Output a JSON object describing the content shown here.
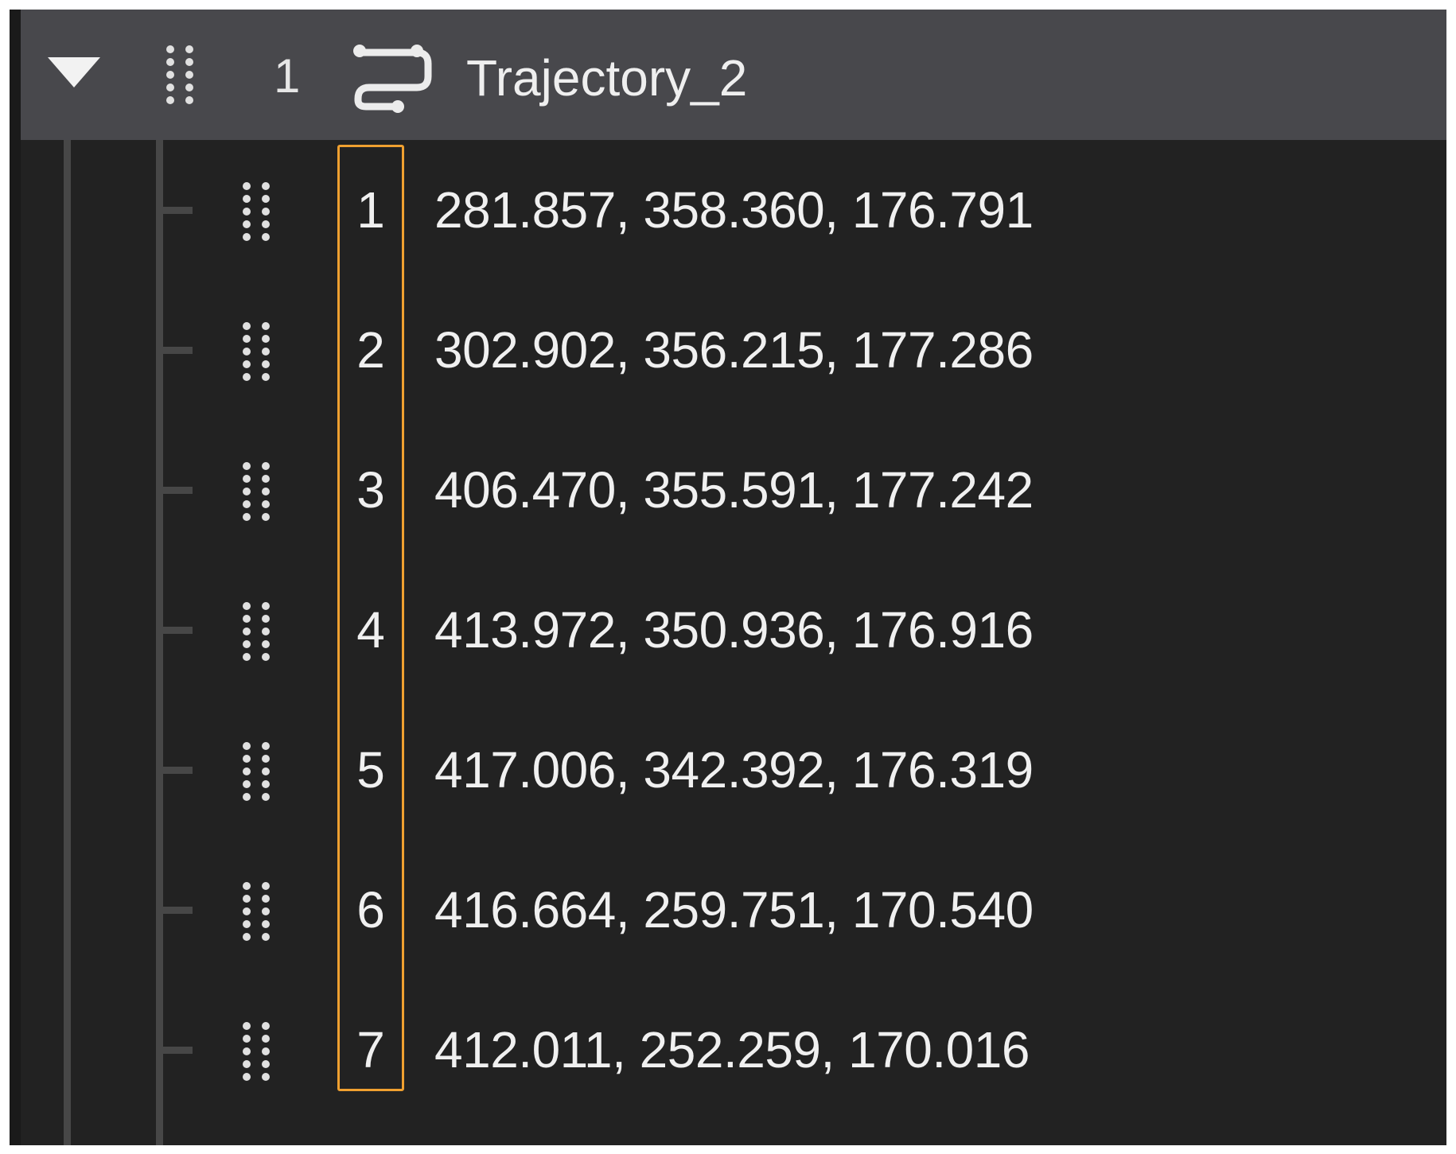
{
  "header": {
    "index": "1",
    "title": "Trajectory_2",
    "icon": "trajectory-icon",
    "expander_icon": "caret-down-icon",
    "grip_icon": "drag-handle-icon"
  },
  "waypoints": [
    {
      "index": "1",
      "coords": "281.857, 358.360, 176.791"
    },
    {
      "index": "2",
      "coords": "302.902, 356.215, 177.286"
    },
    {
      "index": "3",
      "coords": "406.470, 355.591, 177.242"
    },
    {
      "index": "4",
      "coords": "413.972, 350.936, 176.916"
    },
    {
      "index": "5",
      "coords": "417.006, 342.392, 176.319"
    },
    {
      "index": "6",
      "coords": "416.664, 259.751, 170.540"
    },
    {
      "index": "7",
      "coords": "412.011, 252.259, 170.016"
    }
  ],
  "colors": {
    "panel_background": "#222222",
    "header_background": "#48484c",
    "text": "#f0f0f0",
    "selection_highlight": "#f0a030",
    "tree_lines": "#474747"
  }
}
